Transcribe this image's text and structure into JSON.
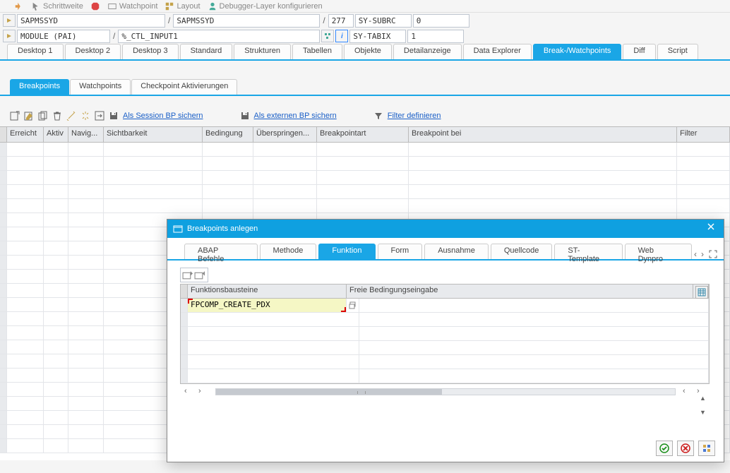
{
  "toolbar": {
    "schrittweite": "Schrittweite",
    "watchpoint": "Watchpoint",
    "layout": "Layout",
    "debugger_layer": "Debugger-Layer konfigurieren"
  },
  "header": {
    "prog1": "SAPMSSYD",
    "prog2": "SAPMSSYD",
    "line": "277",
    "subrc_label": "SY-SUBRC",
    "subrc_val": "0",
    "module": "MODULE (PAI)",
    "ctl": "%_CTL_INPUT1",
    "tabix_label": "SY-TABIX",
    "tabix_val": "1"
  },
  "main_tabs": [
    "Desktop 1",
    "Desktop 2",
    "Desktop 3",
    "Standard",
    "Strukturen",
    "Tabellen",
    "Objekte",
    "Detailanzeige",
    "Data Explorer",
    "Break-/Watchpoints",
    "Diff",
    "Script"
  ],
  "main_tab_active": 9,
  "sub_tabs": [
    "Breakpoints",
    "Watchpoints",
    "Checkpoint Aktivierungen"
  ],
  "sub_tab_active": 0,
  "bp_tb": {
    "session": "Als Session BP sichern",
    "extern": "Als externen BP sichern",
    "filter": "Filter definieren"
  },
  "grid": {
    "cols": [
      "Erreicht",
      "Aktiv",
      "Navig...",
      "Sichtbarkeit",
      "Bedingung",
      "Überspringen...",
      "Breakpointart",
      "Breakpoint bei",
      "Filter"
    ]
  },
  "dialog": {
    "title": "Breakpoints anlegen",
    "tabs": [
      "ABAP Befehle",
      "Methode",
      "Funktion",
      "Form",
      "Ausnahme",
      "Quellcode",
      "ST-Template",
      "Web Dynpro"
    ],
    "tab_active": 2,
    "col1": "Funktionsbausteine",
    "col2": "Freie Bedingungseingabe",
    "value": "FPCOMP_CREATE_PDX"
  }
}
